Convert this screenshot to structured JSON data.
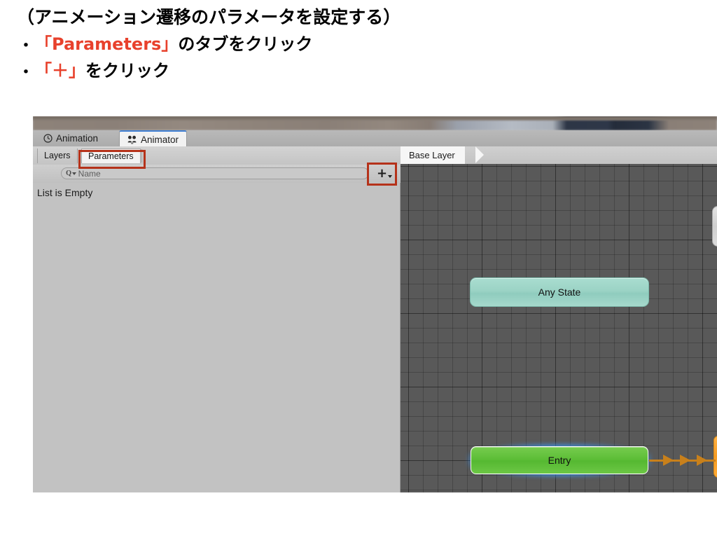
{
  "slide": {
    "title": "（アニメーション遷移のパラメータを設定する）",
    "bullets": [
      {
        "marker": "•",
        "highlight": "「Parameters」",
        "rest": "のタブをクリック"
      },
      {
        "marker": "•",
        "highlight": "「＋」",
        "rest": "をクリック"
      }
    ],
    "highlight_color": "#e8412c"
  },
  "unity": {
    "window_tabs": [
      {
        "label": "Animation",
        "icon": "clock-icon",
        "active": false
      },
      {
        "label": "Animator",
        "icon": "animator-icon",
        "active": true
      }
    ],
    "sub_tabs": [
      {
        "label": "Layers",
        "active": false
      },
      {
        "label": "Parameters",
        "active": true
      }
    ],
    "eye_icon": "eye-icon",
    "search": {
      "icon": "search-icon",
      "placeholder": "Name",
      "value": ""
    },
    "add_button": {
      "label": "+",
      "icon": "plus-icon",
      "dropdown_icon": "chevron-down-icon"
    },
    "parameter_list": {
      "empty_message": "List is Empty",
      "items": []
    },
    "breadcrumb": "Base Layer",
    "graph": {
      "nodes": [
        {
          "name": "Any State",
          "type": "any-state",
          "color": "#9bd3c5"
        },
        {
          "name": "Entry",
          "type": "entry",
          "color": "#5cbd36",
          "selected": true
        },
        {
          "name": "",
          "type": "edge-node-gray",
          "color": "#d6d6d6"
        },
        {
          "name": "",
          "type": "edge-node-orange",
          "color": "#f59b22"
        }
      ],
      "transitions": [
        {
          "from": "Entry",
          "to": "",
          "color": "#c8801b",
          "arrowheads": 3
        }
      ],
      "grid_color": "#595959"
    },
    "highlights": [
      {
        "target": "parameters-tab",
        "color": "#b5321a"
      },
      {
        "target": "add-parameter-button",
        "color": "#b5321a"
      }
    ]
  }
}
